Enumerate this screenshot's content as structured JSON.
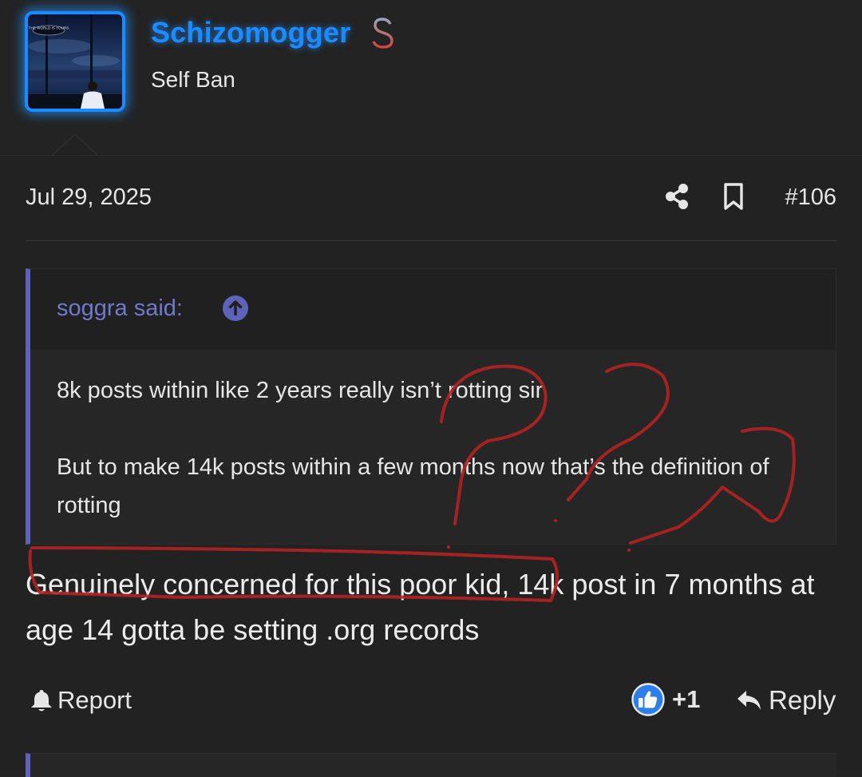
{
  "user": {
    "username": "Schizomogger",
    "title": "Self Ban",
    "avatar_caption": "THE WORLD IS YOURS",
    "badge_icon": "dollar-icon"
  },
  "post": {
    "date": "Jul 29, 2025",
    "number": "#106",
    "quote": {
      "author": "soggra said:",
      "lines": [
        "8k posts within like 2 years really isn’t rotting sir",
        "But to make 14k posts within a few months now that’s the definition of rotting"
      ]
    },
    "body": "Genuinely concerned for this poor kid, 14k post in 7 months at age 14 gotta be setting .org records",
    "actions": {
      "report": "Report",
      "like_count": "+1",
      "reply": "Reply"
    }
  },
  "colors": {
    "username": "#1a8cff",
    "quote_accent": "#5c63b8",
    "annotation": "#b52222",
    "background": "#232323"
  }
}
